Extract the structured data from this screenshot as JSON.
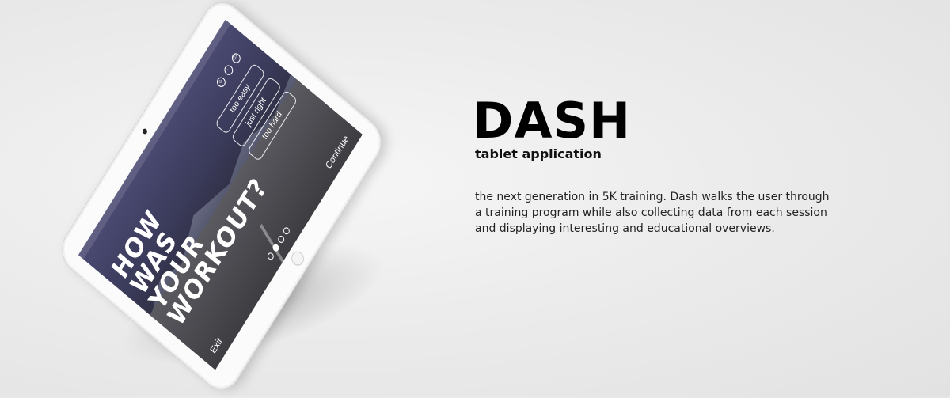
{
  "product": {
    "title": "DASH",
    "subtitle": "tablet application",
    "description": "the next generation in 5K training. Dash walks the user through a training program while also collecting data from each session and displaying interesting and educational overviews."
  },
  "screen": {
    "headline": [
      "HOW",
      "WAS",
      "YOUR",
      "WORKOUT?"
    ],
    "options": [
      "too easy",
      "just right",
      "too hard"
    ],
    "exit_label": "Exit",
    "continue_label": "Continue",
    "page_indicator": {
      "total": 4,
      "active": 2
    }
  },
  "colors": {
    "background": "#e8e8e8",
    "tablet_frame": "#fbfbfb",
    "title_text": "#000000",
    "screen_text": "#ffffff"
  }
}
